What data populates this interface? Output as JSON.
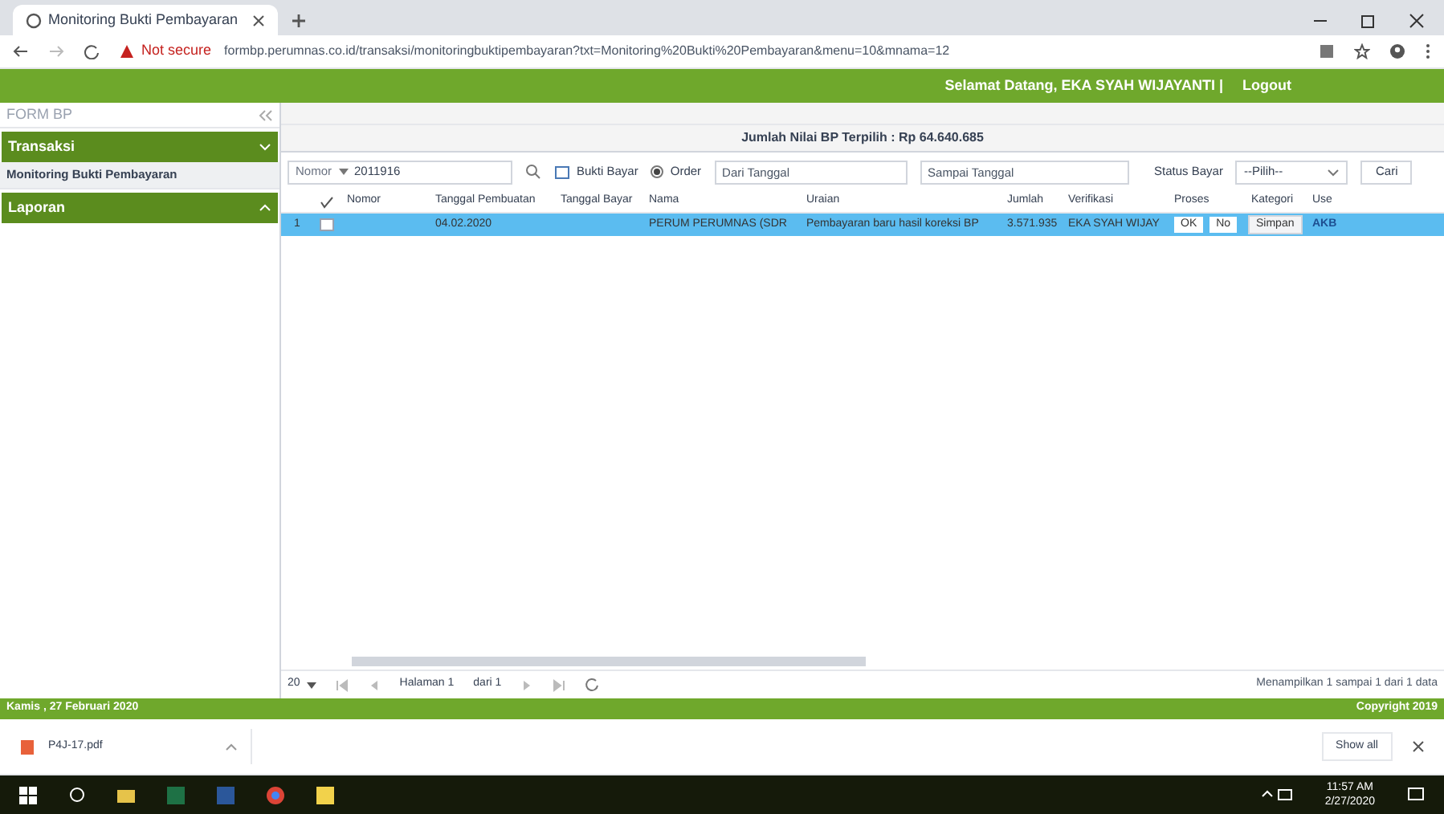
{
  "browser": {
    "tab": {
      "title": "Monitoring Bukti Pembayaran",
      "selected": true
    },
    "security": "Not secure",
    "url": "formbp.perumnas.co.id/transaksi/monitoringbuktipembayaran?txt=Monitoring%20Bukti%20Pembayaran&menu=10&mnama=12"
  },
  "header": {
    "welcome": "Selamat Datang, EKA SYAH WIJAYANTI |",
    "logout": "Logout"
  },
  "sidebar": {
    "title": "FORM BP",
    "items": [
      {
        "label": "Transaksi",
        "kind": "group",
        "expanded": true
      },
      {
        "label": "Monitoring Bukti Pembayaran",
        "kind": "link",
        "selected": true
      },
      {
        "label": "Laporan",
        "kind": "group",
        "expanded": false
      }
    ]
  },
  "panel": {
    "title": "Jumlah Nilai BP Terpilih : Rp 64.640.685",
    "toolbar": {
      "search_by": "Nomor",
      "search_value": "2011916",
      "bukti_bayar": "Bukti Bayar",
      "order": "Order",
      "order_selected": true,
      "from_placeholder": "Dari Tanggal",
      "to_placeholder": "Sampai Tanggal",
      "status_label": "Status Bayar",
      "status_value": "--Pilih--",
      "search_button": "Cari"
    },
    "table": {
      "columns": [
        "Nomor",
        "Tanggal Pembuatan",
        "Tanggal Bayar",
        "Nama",
        "Uraian",
        "Jumlah",
        "Verifikasi",
        "Proses",
        "Kategori",
        "Use"
      ],
      "rows": [
        {
          "number": "1",
          "checked": false,
          "selected": true,
          "nomor": "",
          "tanggal_pembuatan": "04.02.2020",
          "tanggal_bayar": "",
          "nama": "PERUM PERUMNAS (SDR",
          "uraian": "Pembayaran baru hasil koreksi BP",
          "jumlah": "3.571.935",
          "verifikasi": "EKA SYAH WIJAY",
          "ok": "OK",
          "no": "No",
          "button": "Simpan",
          "user": "AKB"
        }
      ]
    },
    "pager": {
      "page_size": "20",
      "page": "Halaman 1",
      "of": "dari 1",
      "summary": "Menampilkan 1 sampai 1 dari 1 data"
    }
  },
  "footer": {
    "date": "Kamis , 27 Februari 2020",
    "copyright": "Copyright 2019"
  },
  "downloads": {
    "file": "P4J-17.pdf",
    "show_all": "Show all"
  },
  "taskbar": {
    "time": "11:57 AM",
    "date": "2/27/2020"
  }
}
